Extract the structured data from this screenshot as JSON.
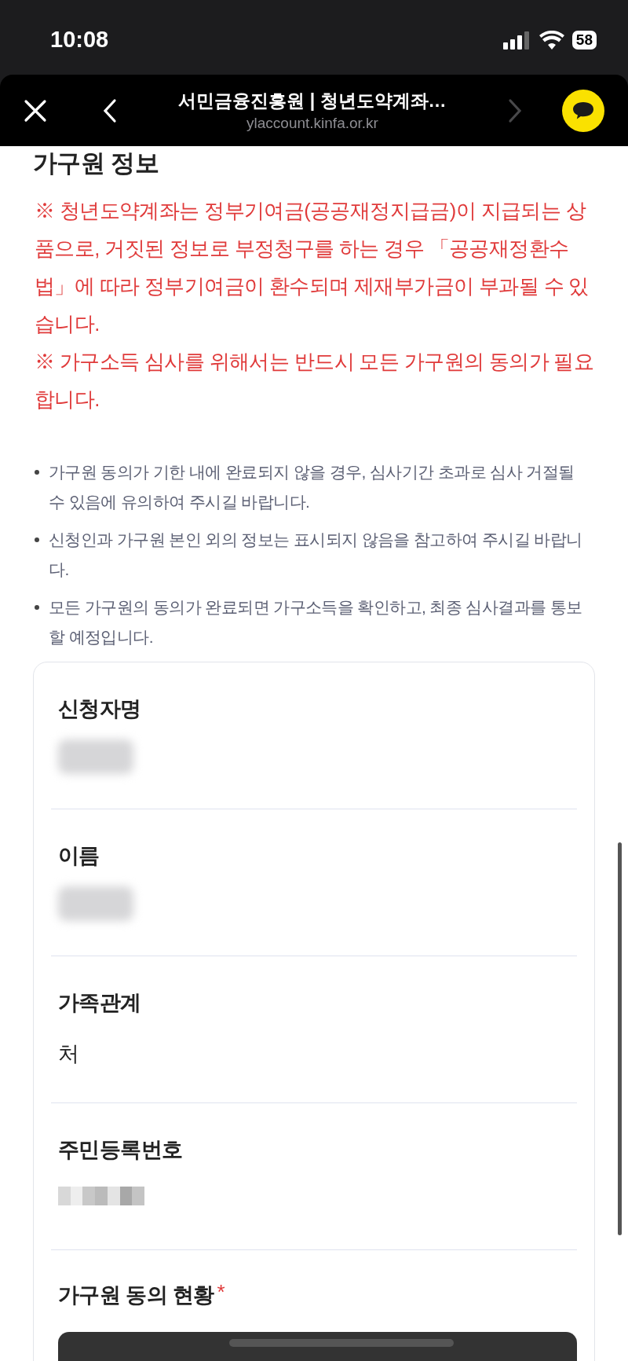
{
  "status_bar": {
    "time": "10:08",
    "battery": "58"
  },
  "browser_bar": {
    "title": "서민금융진흥원 | 청년도약계좌…",
    "url": "ylaccount.kinfa.or.kr",
    "forward_disabled": true
  },
  "section_title": "가구원 정보",
  "warnings": [
    "※ 청년도약계좌는 정부기여금(공공재정지급금)이 지급되는 상품으로, 거짓된 정보로 부정청구를 하는 경우 「공공재정환수법」에 따라 정부기여금이 환수되며 제재부가금이 부과될 수 있습니다.",
    "※ 가구소득 심사를 위해서는 반드시 모든 가구원의 동의가 필요합니다."
  ],
  "notes": [
    "가구원 동의가 기한 내에 완료되지 않을 경우, 심사기간 초과로 심사 거절될 수 있음에 유의하여 주시길 바랍니다.",
    "신청인과 가구원 본인 외의 정보는 표시되지 않음을 참고하여 주시길 바랍니다.",
    "모든 가구원의 동의가 완료되면 가구소득을 확인하고, 최종 심사결과를 통보할 예정입니다."
  ],
  "fields": [
    {
      "label": "신청자명",
      "kind": "redacted"
    },
    {
      "label": "이름",
      "kind": "redacted"
    },
    {
      "label": "가족관계",
      "kind": "text",
      "value": "처"
    },
    {
      "label": "주민등록번호",
      "kind": "pixelated"
    }
  ],
  "consent": {
    "label": "가구원 동의 현황",
    "required_mark": "*"
  }
}
